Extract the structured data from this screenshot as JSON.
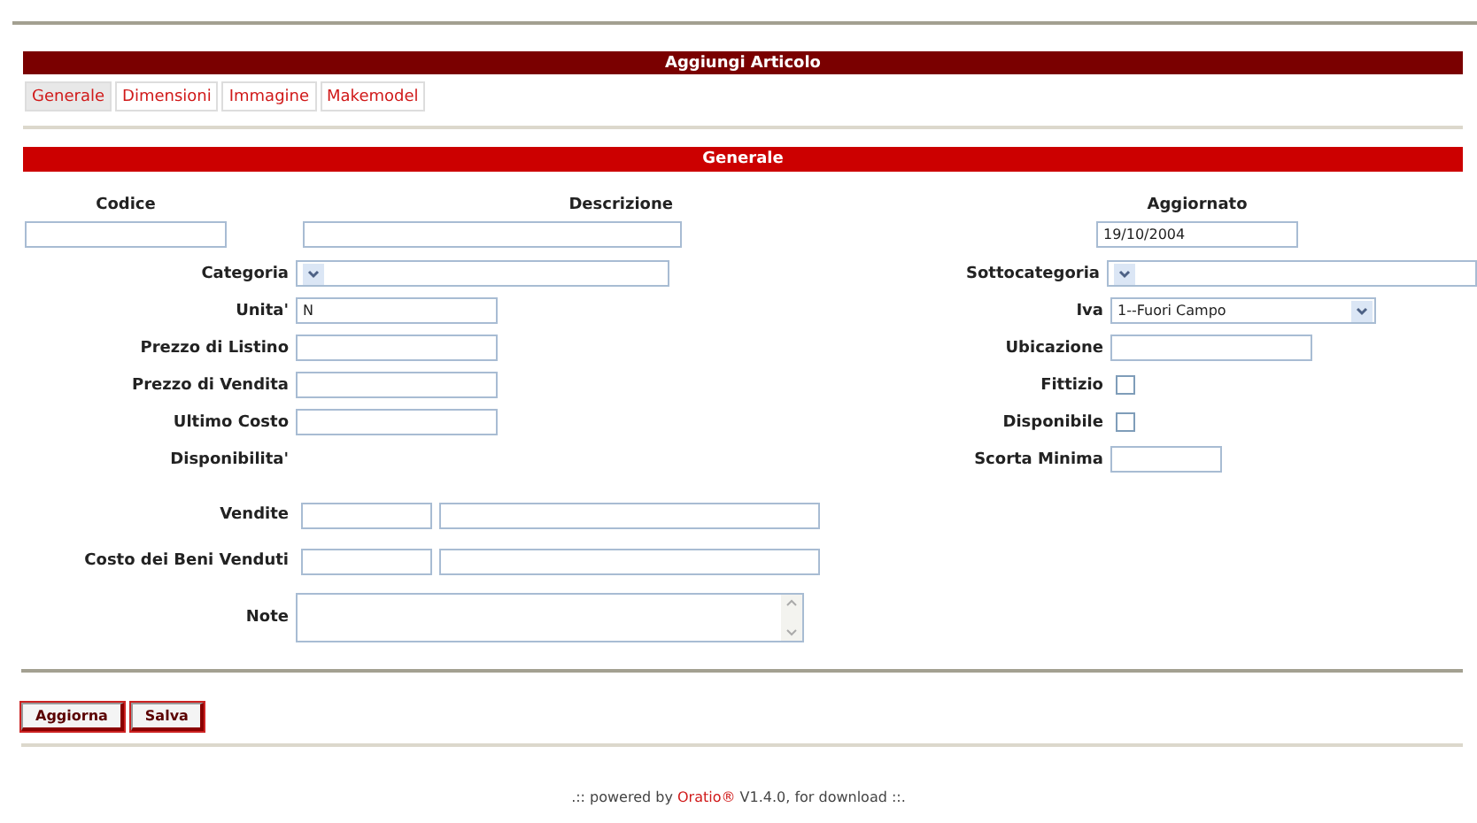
{
  "title": "Aggiungi Articolo",
  "tabs": [
    {
      "label": "Generale",
      "selected": true
    },
    {
      "label": "Dimensioni",
      "selected": false
    },
    {
      "label": "Immagine",
      "selected": false
    },
    {
      "label": "Makemodel",
      "selected": false
    }
  ],
  "section": "Generale",
  "header_fields": [
    {
      "label": "Codice"
    },
    {
      "label": "Descrizione"
    },
    {
      "label": "Aggiornato",
      "value": "19/10/2004"
    }
  ],
  "rows": [
    {
      "left": {
        "kind": "select",
        "label": "Categoria"
      },
      "right": {
        "kind": "select",
        "label": "Sottocategoria"
      }
    },
    {
      "left": {
        "kind": "text",
        "label": "Unita'",
        "value": "N"
      },
      "right": {
        "kind": "select",
        "label": "Iva",
        "value": "1--Fuori Campo"
      }
    },
    {
      "left": {
        "kind": "text",
        "label": "Prezzo di Listino"
      },
      "right": {
        "kind": "text",
        "label": "Ubicazione"
      }
    },
    {
      "left": {
        "kind": "text",
        "label": "Prezzo di Vendita"
      },
      "right": {
        "kind": "checkbox",
        "label": "Fittizio",
        "checked": false
      }
    },
    {
      "left": {
        "kind": "text",
        "label": "Ultimo Costo"
      },
      "right": {
        "kind": "checkbox",
        "label": "Disponibile",
        "checked": false
      }
    },
    {
      "left": {
        "kind": "static",
        "label": "Disponibilita'"
      },
      "right": {
        "kind": "text",
        "label": "Scorta Minima"
      }
    }
  ],
  "pair_fields": [
    {
      "label": "Vendite"
    },
    {
      "label": "Costo dei Beni Venduti"
    }
  ],
  "note": {
    "label": "Note"
  },
  "buttons": [
    "Aggiorna",
    "Salva"
  ],
  "footer": {
    "before": ".:: powered by ",
    "link": "Oratio®",
    "after": " V1.4.0, for download ::."
  }
}
